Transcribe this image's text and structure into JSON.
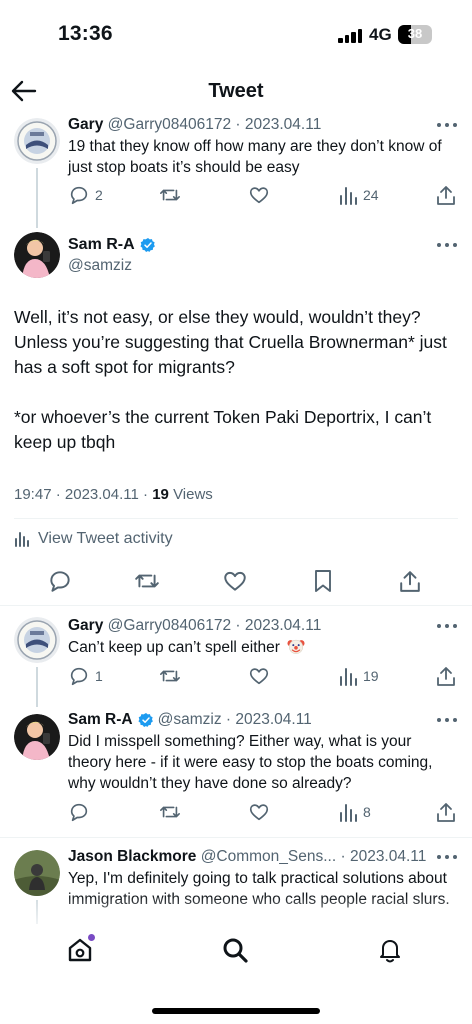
{
  "status_bar": {
    "time": "13:36",
    "network": "4G",
    "battery": "38",
    "battery_level": 0.38
  },
  "header": {
    "title": "Tweet",
    "back_icon": "arrow-left-icon"
  },
  "reply_gary_1": {
    "name": "Gary",
    "handle": "@Garry08406172",
    "date": "2023.04.11",
    "text": "19 that they know off how many are they don’t know of just stop boats it’s should be easy",
    "replies": "2",
    "views": "24"
  },
  "main_tweet": {
    "name": "Sam R-A",
    "handle": "@samziz",
    "paragraph1": "Well, it’s not easy, or else they would, wouldn’t they? Unless you’re suggesting that Cruella Brownerman* just has a soft spot for migrants?",
    "paragraph2": "*or whoever’s the current Token Paki Deportrix, I can’t keep up tbqh",
    "time": "19:47",
    "date": "2023.04.11",
    "views_count": "19",
    "views_label": "Views",
    "activity_label": "View Tweet activity"
  },
  "reply_gary_2": {
    "name": "Gary",
    "handle": "@Garry08406172",
    "date": "2023.04.11",
    "text": "Can’t keep up can’t spell either",
    "replies": "1",
    "views": "19"
  },
  "reply_sam": {
    "name": "Sam R-A",
    "handle": "@samziz",
    "date": "2023.04.11",
    "text": "Did I misspell something? Either way, what is your theory here - if it were easy to stop the boats coming, why wouldn’t they have done so already?",
    "views": "8"
  },
  "reply_jason": {
    "name": "Jason Blackmore",
    "handle": "@Common_Sens...",
    "date": "2023.04.11",
    "text": "Yep, I'm definitely going to talk practical solutions about immigration with someone who calls people racial slurs."
  },
  "colors": {
    "text": "#0f1419",
    "secondary": "#536471",
    "verified": "#1d9bf0",
    "divider": "#eff3f4",
    "thread_line": "#cfd9de",
    "notification_dot": "#794bc4"
  },
  "icons": [
    "reply-icon",
    "retweet-icon",
    "like-icon",
    "views-icon",
    "share-icon",
    "bookmark-icon",
    "more-icon",
    "home-icon",
    "search-icon",
    "notifications-icon"
  ]
}
